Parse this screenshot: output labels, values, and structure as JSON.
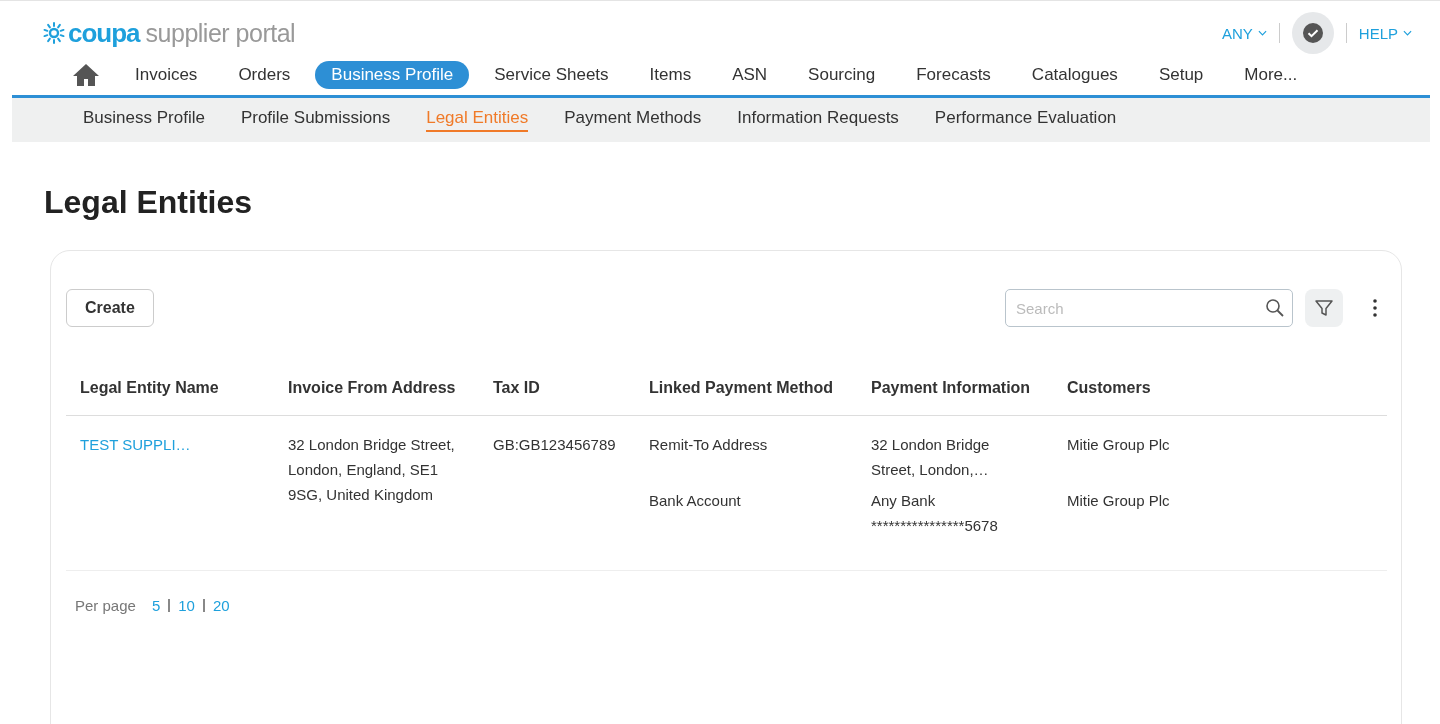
{
  "logo": {
    "brand": "coupa",
    "product": "supplier portal"
  },
  "user_menu": {
    "account": "ANY",
    "help": "HELP"
  },
  "nav": [
    {
      "label": "Invoices",
      "selected": false
    },
    {
      "label": "Orders",
      "selected": false
    },
    {
      "label": "Business Profile",
      "selected": true
    },
    {
      "label": "Service Sheets",
      "selected": false
    },
    {
      "label": "Items",
      "selected": false
    },
    {
      "label": "ASN",
      "selected": false
    },
    {
      "label": "Sourcing",
      "selected": false
    },
    {
      "label": "Forecasts",
      "selected": false
    },
    {
      "label": "Catalogues",
      "selected": false
    },
    {
      "label": "Setup",
      "selected": false
    },
    {
      "label": "More...",
      "selected": false
    }
  ],
  "subnav": [
    {
      "label": "Business Profile",
      "selected": false
    },
    {
      "label": "Profile Submissions",
      "selected": false
    },
    {
      "label": "Legal Entities",
      "selected": true
    },
    {
      "label": "Payment Methods",
      "selected": false
    },
    {
      "label": "Information Requests",
      "selected": false
    },
    {
      "label": "Performance Evaluation",
      "selected": false
    }
  ],
  "page_title": "Legal Entities",
  "toolbar": {
    "create": "Create",
    "search": {
      "placeholder": "Search"
    }
  },
  "table": {
    "columns": [
      "Legal Entity Name",
      "Invoice From Address",
      "Tax ID",
      "Linked Payment Method",
      "Payment Information",
      "Customers"
    ],
    "rows": [
      {
        "name": "TEST SUPPLI…",
        "address": "32 London Bridge Street, London, England, SE1 9SG, United Kingdom",
        "tax_id": "GB:GB123456789",
        "payments": [
          {
            "method": "Remit-To Address",
            "info": [
              "32 London Bridge",
              "Street, London,…"
            ],
            "customer": "Mitie Group Plc"
          },
          {
            "method": "Bank Account",
            "info": [
              "Any Bank",
              "****************5678"
            ],
            "customer": "Mitie Group Plc"
          }
        ]
      }
    ]
  },
  "pagination": {
    "label": "Per page",
    "options": [
      "5",
      "10",
      "20"
    ]
  }
}
